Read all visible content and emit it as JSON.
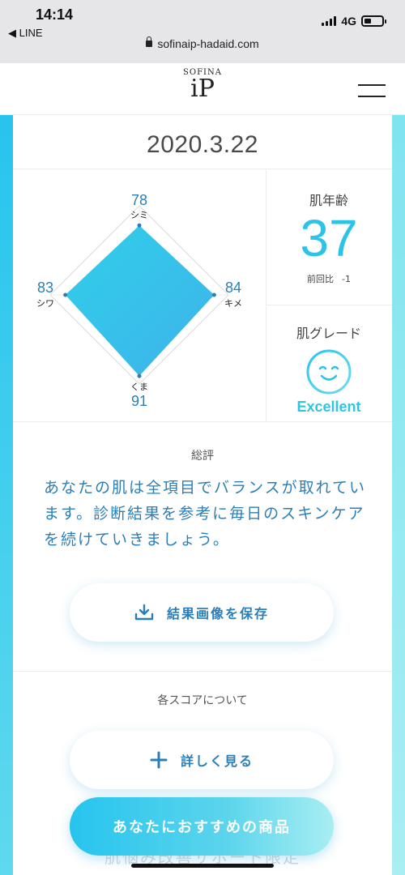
{
  "status_bar": {
    "time": "14:14",
    "back_app": "◀ LINE",
    "network": "4G",
    "battery_level": 0.4
  },
  "browser": {
    "url": "sofinaip-hadaid.com"
  },
  "header": {
    "logo_sub": "SOFINA",
    "logo_main": "iP"
  },
  "result": {
    "date": "2020.3.22",
    "radar": {
      "top": {
        "label": "シミ",
        "value": "78"
      },
      "right": {
        "label": "キメ",
        "value": "84"
      },
      "bottom": {
        "label": "くま",
        "value": "91"
      },
      "left": {
        "label": "シワ",
        "value": "83"
      }
    },
    "skin_age": {
      "label": "肌年齢",
      "value": "37",
      "diff_label": "前回比",
      "diff_value": "-1"
    },
    "grade": {
      "label": "肌グレード",
      "value": "Excellent",
      "icon": "smile-face-icon"
    },
    "summary": {
      "label": "総評",
      "text": "あなたの肌は全項目でバランスが取れています。診断結果を参考に毎日のスキンケアを続けていきましょう。"
    },
    "save_button": "結果画像を保存",
    "score_section_label": "各スコアについて",
    "more_button": "詳しく見る",
    "behind_text": "肌悩み改善サポート限定"
  },
  "cta": {
    "label": "あなたにおすすめの商品"
  },
  "colors": {
    "accent": "#2cc3e8",
    "text_blue": "#2a7fb8"
  }
}
